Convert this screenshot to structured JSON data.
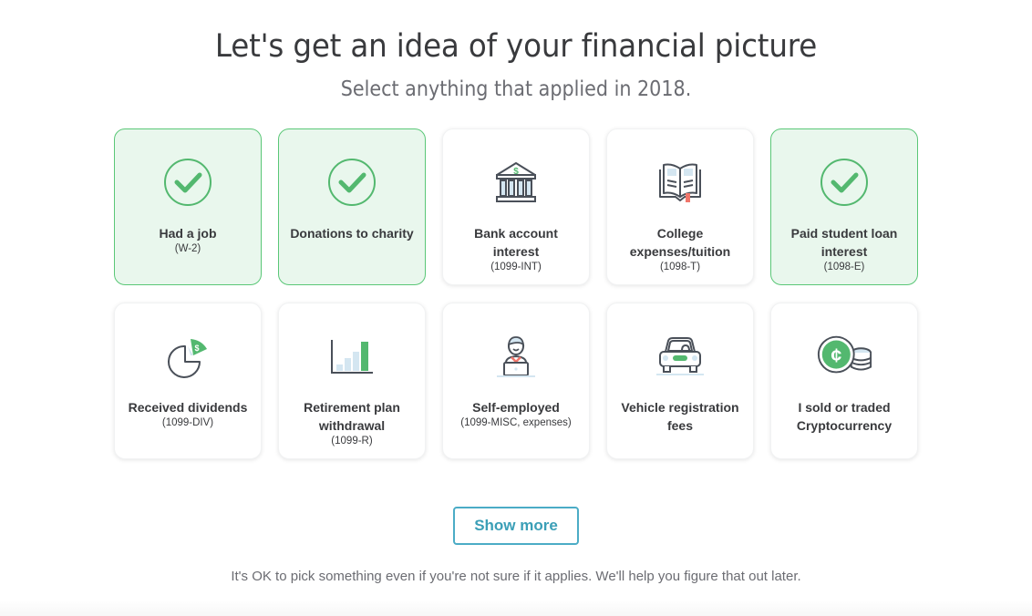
{
  "header": {
    "title": "Let's get an idea of your financial picture",
    "subtitle": "Select anything that applied in 2018."
  },
  "colors": {
    "selected_border": "#5ac777",
    "selected_bg": "#e9f7ed",
    "accent_green": "#53b86f",
    "button_teal": "#4bacc6",
    "icon_stroke": "#4a5059",
    "icon_fill_light": "#d4e6f1",
    "accent_red": "#f0766b"
  },
  "cards": [
    {
      "label": "Had a job",
      "sub": "(W-2)",
      "icon": "checkmark-icon",
      "selected": true
    },
    {
      "label": "Donations to charity",
      "sub": "",
      "icon": "checkmark-icon",
      "selected": true
    },
    {
      "label": "Bank account interest",
      "sub": "(1099-INT)",
      "icon": "bank-icon",
      "selected": false
    },
    {
      "label": "College expenses/tuition",
      "sub": "(1098-T)",
      "icon": "book-icon",
      "selected": false
    },
    {
      "label": "Paid student loan interest",
      "sub": "(1098-E)",
      "icon": "checkmark-icon",
      "selected": true
    },
    {
      "label": "Received dividends",
      "sub": "(1099-DIV)",
      "icon": "pie-chart-dollar-icon",
      "selected": false
    },
    {
      "label": "Retirement plan withdrawal",
      "sub": "(1099-R)",
      "icon": "bar-chart-icon",
      "selected": false
    },
    {
      "label": "Self-employed",
      "sub": "(1099-MISC, expenses)",
      "icon": "person-laptop-icon",
      "selected": false
    },
    {
      "label": "Vehicle registration fees",
      "sub": "",
      "icon": "car-icon",
      "selected": false
    },
    {
      "label": "I sold or traded Cryptocurrency",
      "sub": "",
      "icon": "crypto-coins-icon",
      "selected": false
    }
  ],
  "actions": {
    "show_more": "Show more"
  },
  "hint": "It's OK to pick something even if you're not sure if it applies. We'll help you figure that out later."
}
